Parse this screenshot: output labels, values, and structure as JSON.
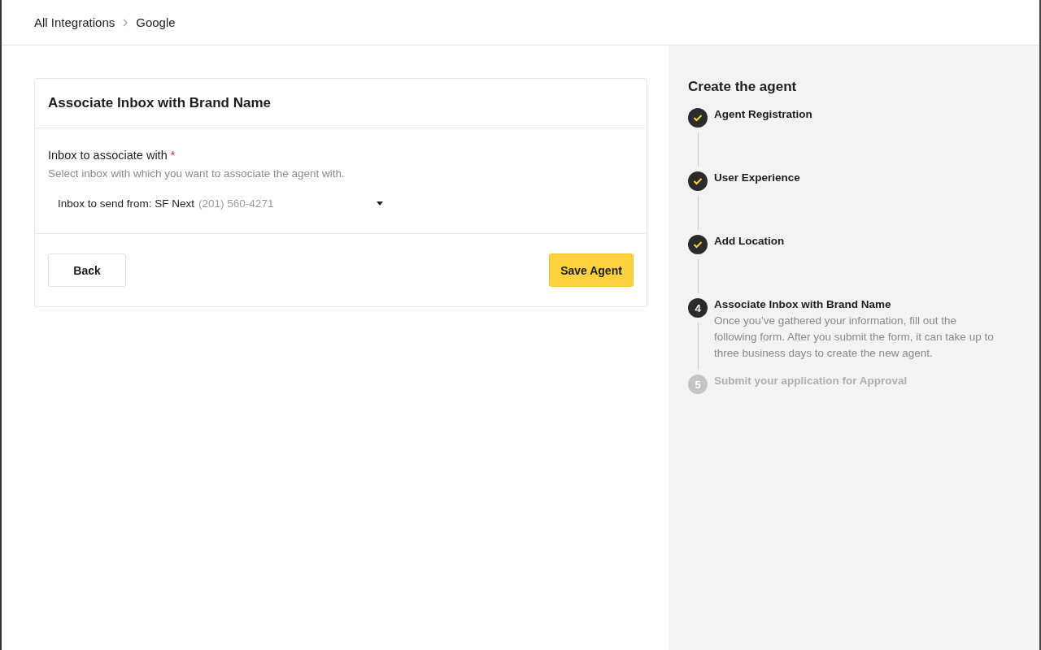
{
  "breadcrumb": [
    {
      "label": "All Integrations"
    },
    {
      "label": "Google"
    }
  ],
  "card": {
    "title": "Associate Inbox with Brand Name",
    "field": {
      "label": "Inbox to associate with",
      "required_mark": "*",
      "hint": "Select inbox with which you want to associate the agent with.",
      "value": "Inbox to send from: SF Next",
      "value_detail": "(201) 560-4271"
    },
    "buttons": [
      {
        "label": "Back",
        "kind": "secondary"
      },
      {
        "label": "Save Agent",
        "kind": "primary"
      }
    ]
  },
  "stepper": {
    "title": "Create the agent",
    "steps": [
      {
        "label": "Agent Registration",
        "completed": true,
        "disabled": false
      },
      {
        "label": "User Experience",
        "completed": true,
        "disabled": false
      },
      {
        "label": "Add Location",
        "completed": true,
        "disabled": false
      },
      {
        "label": "Associate Inbox with Brand Name",
        "completed": false,
        "disabled": false,
        "number": "4",
        "description": "Once you’ve gathered your information, fill out the following form. After you submit the form, it can take up to three business days to create the new agent."
      },
      {
        "label": "Submit your application for Approval",
        "completed": false,
        "disabled": true,
        "number": "5"
      }
    ]
  }
}
